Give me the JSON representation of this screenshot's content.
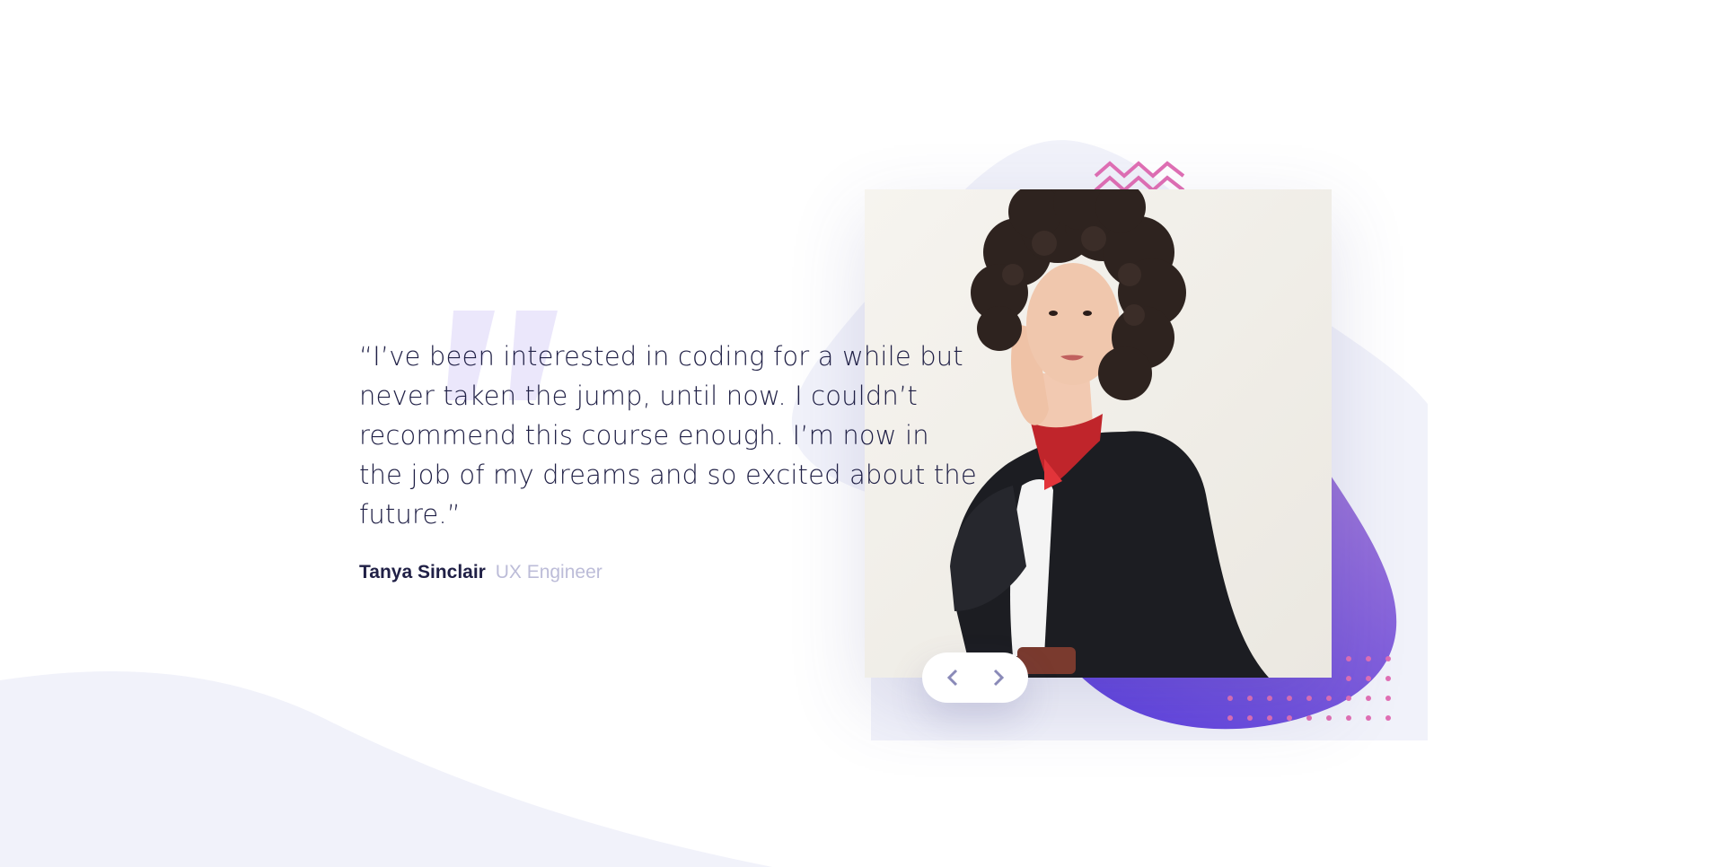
{
  "testimonial": {
    "quote": "“I’ve been interested in coding for a while but never taken the jump, until now. I couldn’t recommend this course enough. I’m now in the job of my dreams and so excited about the future.”",
    "author_name": "Tanya Sinclair",
    "author_role": "UX Engineer"
  },
  "photo": {
    "subject": "Tanya Sinclair"
  },
  "navigation": {
    "prev_icon": "chevron-left-icon",
    "next_icon": "chevron-right-icon"
  },
  "colors": {
    "text_dark": "#202046",
    "text_muted": "#bcbcd8",
    "blob_purple": "#6c4fd9",
    "blob_light": "#f1f2fa",
    "zigzag_pink": "#e06fb4",
    "dots_pink": "#e06fb4",
    "quote_mark": "#ebe7fb"
  }
}
